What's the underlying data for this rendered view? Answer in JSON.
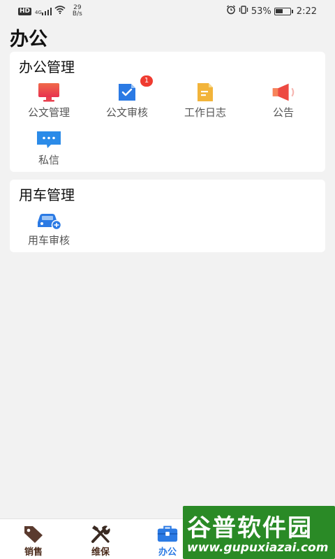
{
  "status_bar": {
    "hd": "HD",
    "network": "4G",
    "speed_top": "29",
    "speed_bottom": "B/s",
    "battery_percent": "53%",
    "battery_level": 0.53,
    "time": "2:22"
  },
  "page": {
    "title": "办公"
  },
  "office_section": {
    "title": "办公管理",
    "items": [
      {
        "label": "公文管理",
        "icon": "monitor-icon",
        "color": "#e8414f"
      },
      {
        "label": "公文审核",
        "icon": "document-check-icon",
        "color": "#2b7ae4",
        "badge": "1"
      },
      {
        "label": "工作日志",
        "icon": "notebook-icon",
        "color": "#f2b43a"
      },
      {
        "label": "公告",
        "icon": "megaphone-icon",
        "color": "#e8414f"
      },
      {
        "label": "私信",
        "icon": "chat-bubble-icon",
        "color": "#2b8be8"
      }
    ]
  },
  "vehicle_section": {
    "title": "用车管理",
    "items": [
      {
        "label": "用车审核",
        "icon": "car-approve-icon",
        "color": "#2b7ae4"
      }
    ]
  },
  "bottom_nav": {
    "items": [
      {
        "label": "销售",
        "icon": "tag-icon"
      },
      {
        "label": "维保",
        "icon": "tools-icon"
      },
      {
        "label": "办公",
        "icon": "briefcase-icon",
        "active": true
      }
    ]
  },
  "watermark": {
    "line1": "谷普软件园",
    "line2": "www.gupuxiazai.com"
  }
}
